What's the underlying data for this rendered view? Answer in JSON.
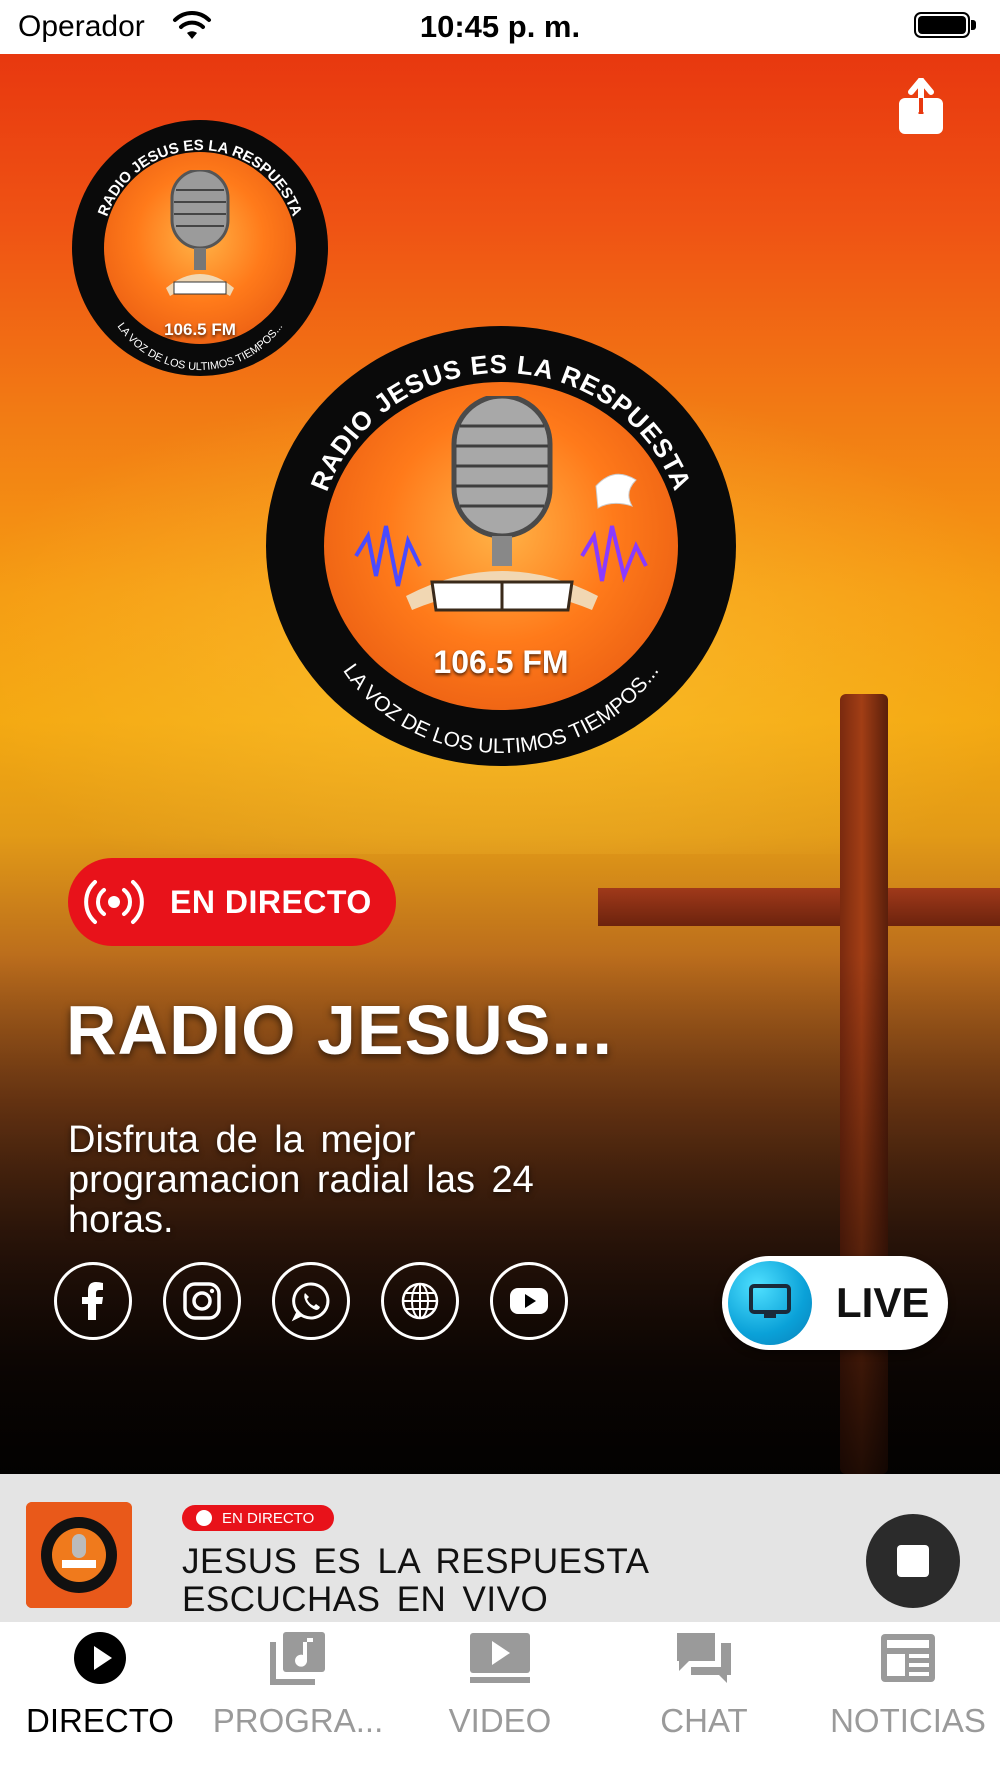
{
  "status_bar": {
    "carrier": "Operador",
    "time": "10:45 p. m."
  },
  "logo": {
    "arc_top": "RADIO JESUS  ES  LA RESPUESTA",
    "arc_bottom": "LA VOZ DE LOS ULTIMOS TIEMPOS...",
    "frequency": "106.5 FM"
  },
  "hero": {
    "live_badge": "EN DIRECTO",
    "station_title": "RADIO JESUS...",
    "description": "Disfruta de la mejor programacion radial las 24 horas.",
    "social": [
      "facebook-icon",
      "instagram-icon",
      "whatsapp-icon",
      "globe-icon",
      "youtube-icon"
    ],
    "live_button": "LIVE"
  },
  "player": {
    "badge": "EN DIRECTO",
    "line1": "JESUS ES LA RESPUESTA",
    "line2": "ESCUCHAS EN VIVO"
  },
  "tabs": [
    {
      "label": "DIRECTO",
      "icon": "play-circle-icon",
      "active": true
    },
    {
      "label": "PROGRA...",
      "icon": "music-note-icon",
      "active": false
    },
    {
      "label": "VIDEO",
      "icon": "video-play-icon",
      "active": false
    },
    {
      "label": "CHAT",
      "icon": "chat-bubbles-icon",
      "active": false
    },
    {
      "label": "NOTICIAS",
      "icon": "newspaper-icon",
      "active": false
    }
  ],
  "colors": {
    "live_red": "#e8121a",
    "accent_blue": "#0aa1d8",
    "sky_orange": "#f27a14"
  }
}
